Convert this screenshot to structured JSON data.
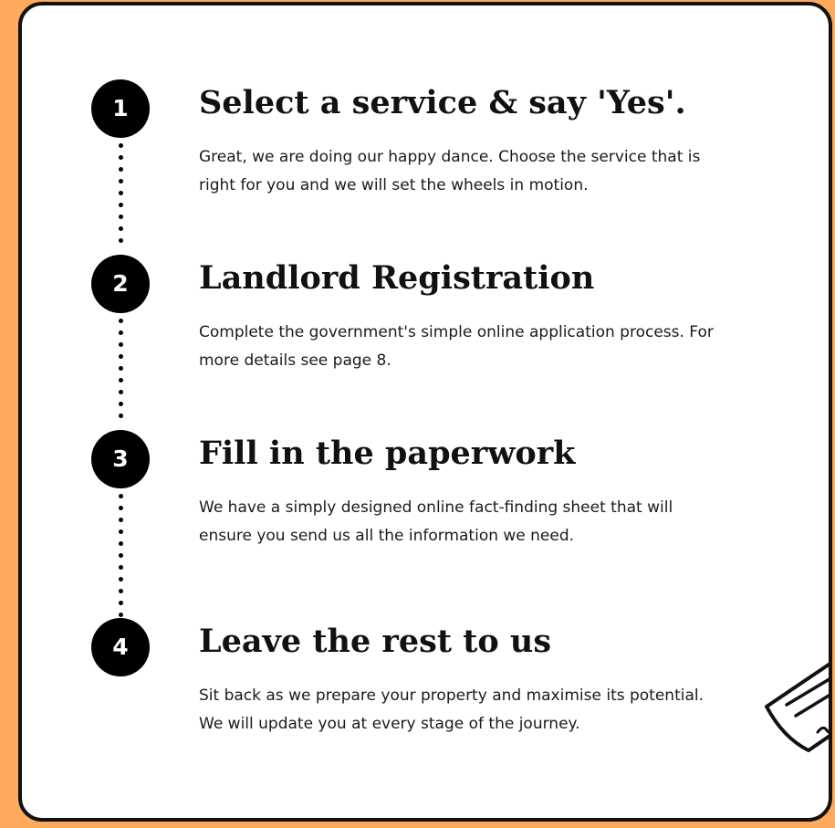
{
  "steps": [
    {
      "number": "1",
      "title": "Select a service & say 'Yes'.",
      "description": "Great, we are doing our happy dance. Choose the service that is right for you and we will set the wheels in motion."
    },
    {
      "number": "2",
      "title": "Landlord Registration",
      "description": "Complete the government's simple online application process. For more details see page 8."
    },
    {
      "number": "3",
      "title": "Fill in the paperwork",
      "description": "We have a simply designed online fact-finding sheet that will ensure you send us all the information we need."
    },
    {
      "number": "4",
      "title": "Leave the rest to us",
      "description": "Sit back as we prepare your property and maximise its potential. We will update you at every stage of the journey."
    }
  ],
  "colors": {
    "background": "#FDAA5A",
    "card": "#ffffff",
    "border": "#111111",
    "circle": "#000000"
  },
  "decoration_icon": "document-sketch-icon"
}
